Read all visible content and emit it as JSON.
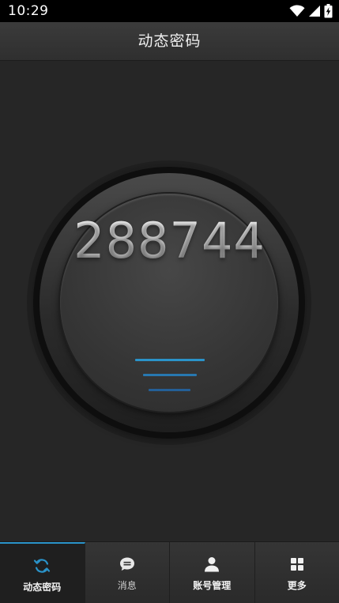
{
  "status_bar": {
    "time": "10:29",
    "icons": [
      "wifi-icon",
      "signal-icon",
      "battery-charging-icon"
    ]
  },
  "header": {
    "title": "动态密码"
  },
  "otp": {
    "code": "288744",
    "accent_color": "#2a93c9"
  },
  "bottom_nav": {
    "tabs": [
      {
        "label": "动态密码",
        "icon": "refresh-icon",
        "active": true
      },
      {
        "label": "消息",
        "icon": "chat-bubble-icon",
        "active": false
      },
      {
        "label": "账号管理",
        "icon": "user-icon",
        "active": false
      },
      {
        "label": "更多",
        "icon": "grid-icon",
        "active": false
      }
    ]
  }
}
